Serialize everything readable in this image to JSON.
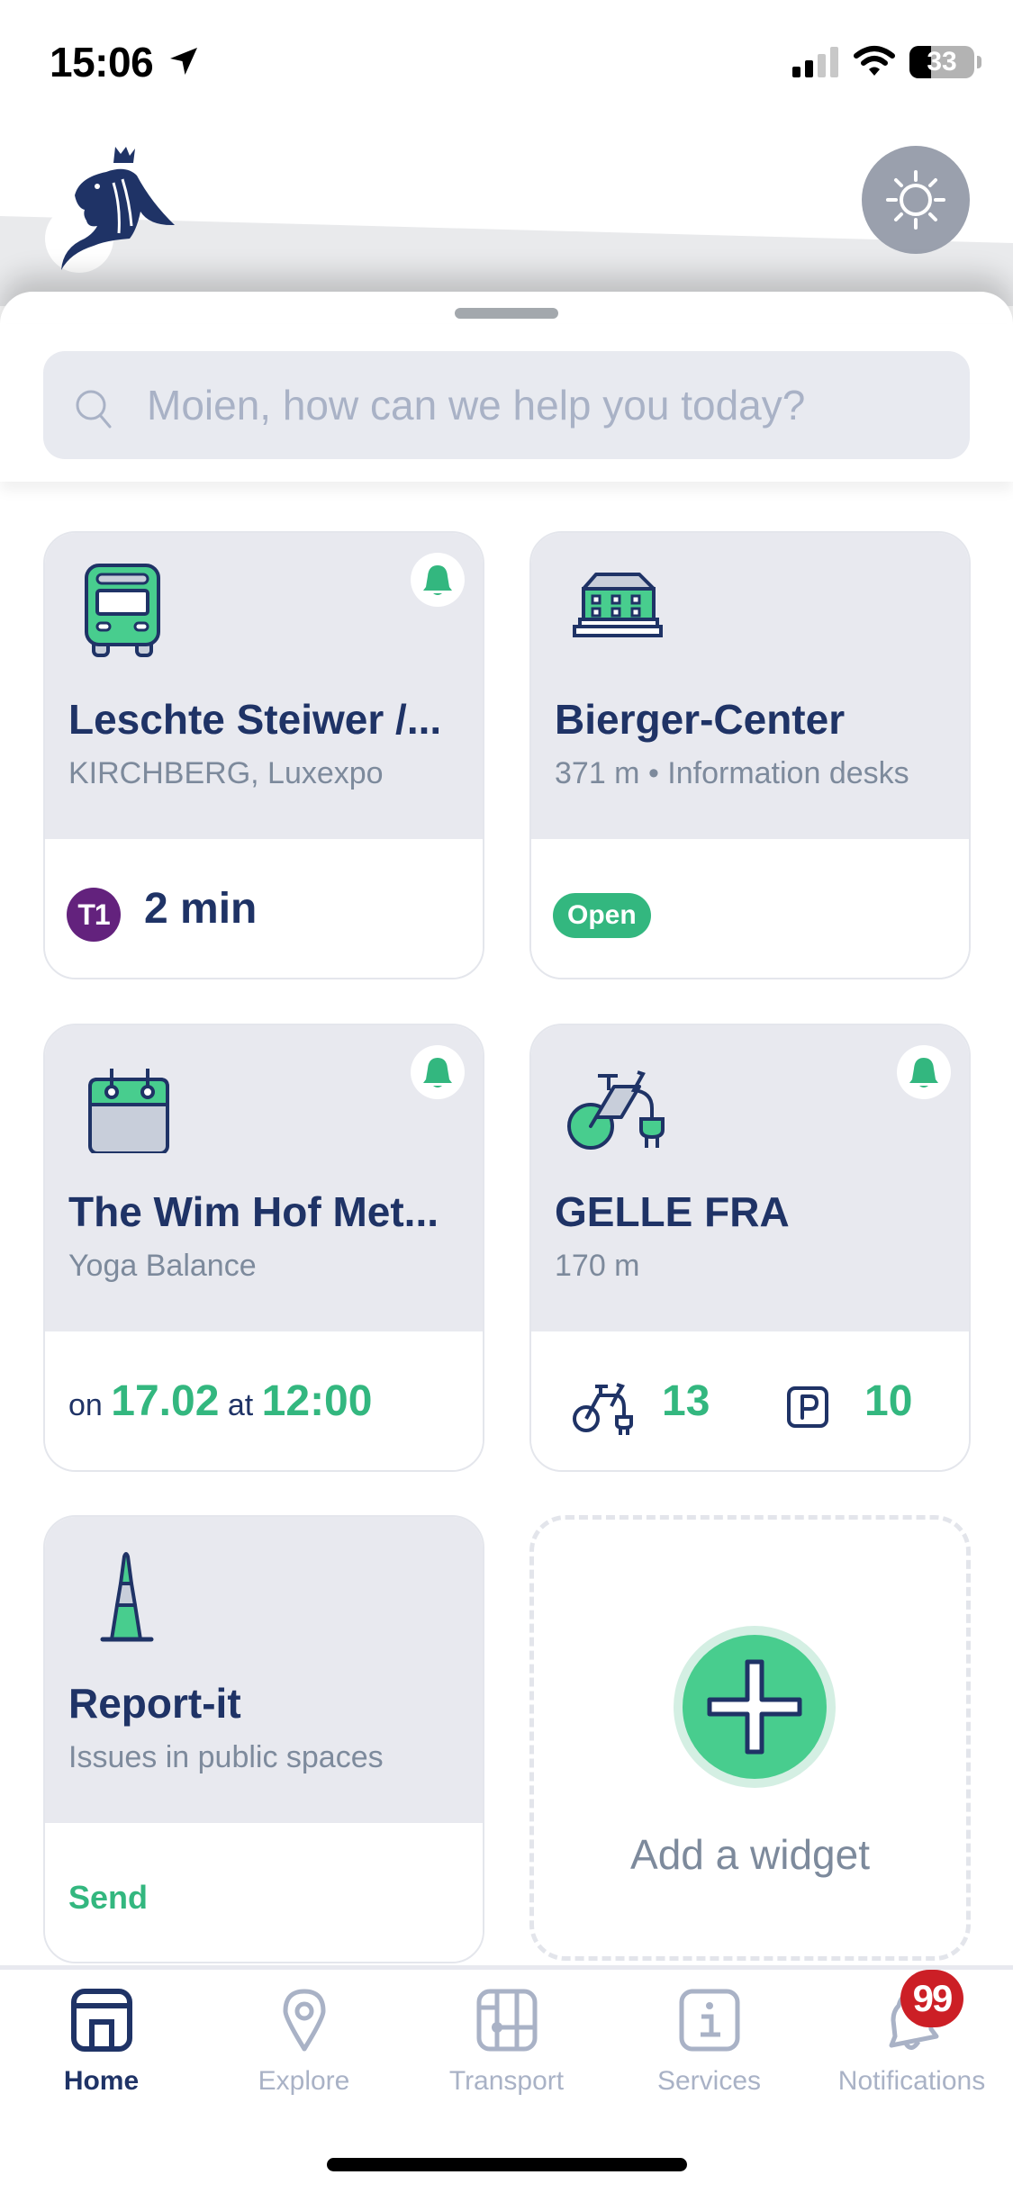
{
  "status_bar": {
    "time": "15:06",
    "battery_percent": 33,
    "battery_label": "33",
    "signal_bars_active": 2,
    "signal_bars_total": 4
  },
  "header": {
    "logo": "lion-crest-logo",
    "theme_toggle": "sun-icon"
  },
  "search": {
    "placeholder": "Moien, how can we help you today?",
    "value": ""
  },
  "colors": {
    "primary_navy": "#1f3366",
    "accent_green": "#33b77f",
    "card_bg": "#e8e9ef",
    "muted_text": "#7d8a9c",
    "tram_purple": "#63227d",
    "badge_red": "#cc1f26"
  },
  "widgets": [
    {
      "type": "transport-stop",
      "icon": "bus-icon",
      "has_alert_bell": true,
      "title": "Leschte Steiwer /...",
      "subtitle": "KIRCHBERG, Luxexpo",
      "line": "T1",
      "eta": "2 min"
    },
    {
      "type": "service-point",
      "icon": "building-icon",
      "has_alert_bell": false,
      "title": "Bierger-Center",
      "subtitle": "371 m • Information desks",
      "status": "Open"
    },
    {
      "type": "event",
      "icon": "calendar-icon",
      "has_alert_bell": true,
      "title": "The Wim Hof Met...",
      "subtitle": "Yoga Balance",
      "on_label": "on",
      "date": "17.02",
      "at_label": "at",
      "time": "12:00"
    },
    {
      "type": "bike-station",
      "icon": "e-bike-icon",
      "has_alert_bell": true,
      "title": "GELLE FRA",
      "subtitle": "170 m",
      "bikes_available": "13",
      "parking_available": "10"
    },
    {
      "type": "report",
      "icon": "traffic-cone-icon",
      "has_alert_bell": false,
      "title": "Report-it",
      "subtitle": "Issues in public spaces",
      "action": "Send"
    }
  ],
  "add_widget": {
    "label": "Add a widget"
  },
  "tabbar": {
    "items": [
      {
        "label": "Home",
        "icon": "home-icon",
        "active": true
      },
      {
        "label": "Explore",
        "icon": "map-pin-icon",
        "active": false
      },
      {
        "label": "Transport",
        "icon": "transport-map-icon",
        "active": false
      },
      {
        "label": "Services",
        "icon": "info-icon",
        "active": false
      },
      {
        "label": "Notifications",
        "icon": "bell-icon",
        "active": false
      }
    ],
    "notifications_badge": "99"
  }
}
